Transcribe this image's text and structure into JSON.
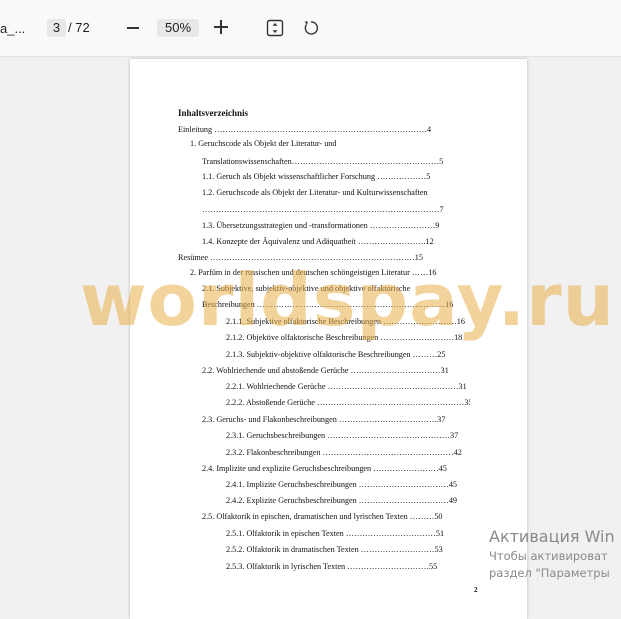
{
  "toolbar": {
    "doc_title": "a_...",
    "page_current": "3",
    "page_total": "/ 72",
    "zoom": "50%"
  },
  "icons": {
    "zoom_out": "minus-icon",
    "zoom_in": "plus-icon",
    "fit": "fit-page-icon",
    "rotate": "rotate-icon"
  },
  "document": {
    "title": "Inhaltsverzeichnis",
    "entries": [
      "Einleitung ……………………………………………………………………4",
      "1.  Geruchscode           als           Objekt           der           Literatur-           und",
      "Translationswissenschaften………………………………………………5",
      "1.1.   Geruch als Objekt wissenschaftlicher Forschung ………………5",
      "1.2.   Geruchscode als Objekt der Literatur- und Kulturwissenschaften",
      "……………………………………………………………………………7",
      "1.3.   Übersetzungsstrategien und -transformationen ……………………9",
      "1.4.   Konzepte der Äquivalenz und Adäquatheit …………………….12",
      "Resümee …………………………………………………………………15",
      "2.  Parfüm in der russischen und deutschen schöngeistigen Literatur ……16",
      "2.1.   Subjektive, subjektiv-objektive und objektive olfaktorische",
      "Beschreibungen ……………………………………………………………16",
      "2.1.1. Subjektive olfaktorische Beschreibungen ………………………16",
      "2.1.2. Objektive olfaktorische Beschreibungen ………………………18",
      "2.1.3. Subjektiv-objektive olfaktorische Beschreibungen ………25",
      "2.2. Wohlriechende und abstoßende Gerüche ……………………………31",
      "2.2.1. Wohlriechende Gerüche …………………………………………31",
      "2.2.2. Abstoßende Gerüche ………………………………………………35",
      "2.3. Geruchs- und Flakonbeschreibungen ………………………………37",
      "2.3.1. Geruchsbeschreibungen ………………………………………37",
      "2.3.2. Flakonbeschreibungen …………………………………………42",
      "2.4. Implizite und explizite Geruchsbeschreibungen ……………………45",
      "2.4.1. Implizite Geruchsbeschreibungen ……………………………45",
      "2.4.2. Explizite Geruchsbeschreibungen ……………………………49",
      "2.5. Olfaktorik in epischen, dramatischen und lyrischen Texten ………50",
      "2.5.1. Olfaktorik in epischen Texten ……………………………51",
      "2.5.2. Olfaktorik in dramatischen Texten ………………………53",
      "2.5.3. Olfaktorik in lyrischen Texten …………………………55"
    ],
    "page_number": "2"
  },
  "watermark": "worldspay.ru",
  "activation": {
    "title": "Активация Win",
    "line1": "Чтобы активироват",
    "line2": "раздел \"Параметры"
  }
}
